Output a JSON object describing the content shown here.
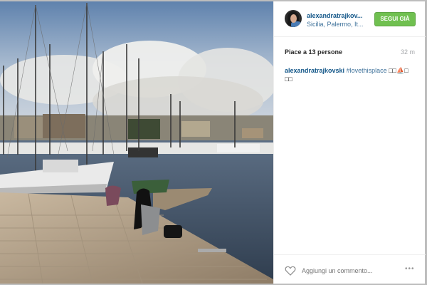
{
  "post": {
    "username": "alexandratrajkov...",
    "location": "Sicilia, Palermo, It...",
    "follow_label": "SEGUI GIÀ",
    "likes": "Piace a 13 persone",
    "time": "32 m",
    "caption_user": "alexandratrajkovski",
    "caption_tag": "#lovethisplace",
    "caption_tail": " □□⛵□",
    "caption_tail2": "□□",
    "comment_placeholder": "Aggiungi un commento...",
    "more_label": "•••"
  },
  "icons": {
    "heart": "heart-icon",
    "more": "more-options-icon",
    "avatar": "avatar"
  },
  "colors": {
    "username": "#125688",
    "hashtag": "#3f729b",
    "follow_button": "#70c050",
    "panel_bg": "#ffffff",
    "page_bg": "#bdbdbd"
  }
}
